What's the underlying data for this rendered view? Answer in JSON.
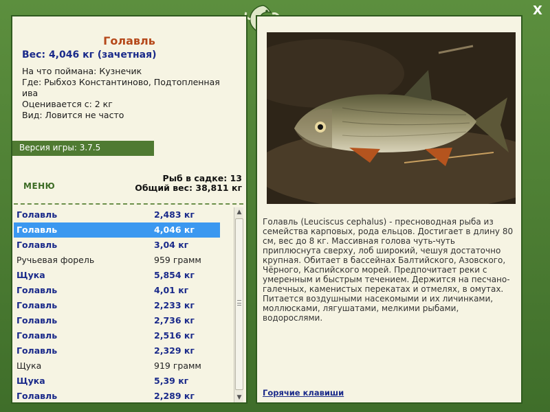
{
  "window": {
    "close_label": "X"
  },
  "fish_info": {
    "title": "Голавль",
    "weight": "Вес: 4,046 кг (зачетная)",
    "lines": [
      "На что поймана: Кузнечик",
      "Где: Рыбхоз Константиново, Подтопленная",
      "ива",
      "Оценивается с: 2 кг",
      "Вид: Ловится не часто"
    ]
  },
  "version": "Версия игры: 3.7.5",
  "menu_label": "МЕНЮ",
  "cage": {
    "count": "Рыб в садке: 13",
    "total": "Общий вес: 38,811 кг"
  },
  "catch_list": [
    {
      "name": "Голавль",
      "weight": "2,483 кг",
      "trophy": true,
      "selected": false
    },
    {
      "name": "Голавль",
      "weight": "4,046 кг",
      "trophy": true,
      "selected": true
    },
    {
      "name": "Голавль",
      "weight": "3,04 кг",
      "trophy": true,
      "selected": false
    },
    {
      "name": "Ручьевая форель",
      "weight": "959 грамм",
      "trophy": false,
      "selected": false
    },
    {
      "name": "Щука",
      "weight": "5,854 кг",
      "trophy": true,
      "selected": false
    },
    {
      "name": "Голавль",
      "weight": "4,01 кг",
      "trophy": true,
      "selected": false
    },
    {
      "name": "Голавль",
      "weight": "2,233 кг",
      "trophy": true,
      "selected": false
    },
    {
      "name": "Голавль",
      "weight": "2,736 кг",
      "trophy": true,
      "selected": false
    },
    {
      "name": "Голавль",
      "weight": "2,516 кг",
      "trophy": true,
      "selected": false
    },
    {
      "name": "Голавль",
      "weight": "2,329 кг",
      "trophy": true,
      "selected": false
    },
    {
      "name": "Щука",
      "weight": "919 грамм",
      "trophy": false,
      "selected": false
    },
    {
      "name": "Щука",
      "weight": "5,39 кг",
      "trophy": true,
      "selected": false
    },
    {
      "name": "Голавль",
      "weight": "2,289 кг",
      "trophy": true,
      "selected": false
    }
  ],
  "description": "Голавль (Leuciscus cephalus) - пресноводная рыба из семейства карповых, рода ельцов. Достигает в длину 80 см, вес до 8 кг. Массивная голова чуть-чуть приплюснута сверху, лоб широкий, чешуя достаточно крупная. Обитает в бассейнах Балтийского, Азовского, Чёрного, Каспийского морей. Предпочитает реки с умеренным и быстрым течением. Держится на песчано-галечных, каменистых перекатах и отмелях, в омутах. Питается воздушными насекомыми и их личинками, моллюсками, лягушатами, мелкими рыбами, водорослями.",
  "hotkeys_label": "Горячие клавиши",
  "colors": {
    "frame": "#4a7a34",
    "panel": "#f6f4e3",
    "title": "#b5481a",
    "trophy": "#1a2a8a",
    "selection": "#3b98f0"
  },
  "icons": {
    "close": "close-icon",
    "logo": "lizard-logo-icon",
    "fish_photo": "chub-fish-photo"
  }
}
